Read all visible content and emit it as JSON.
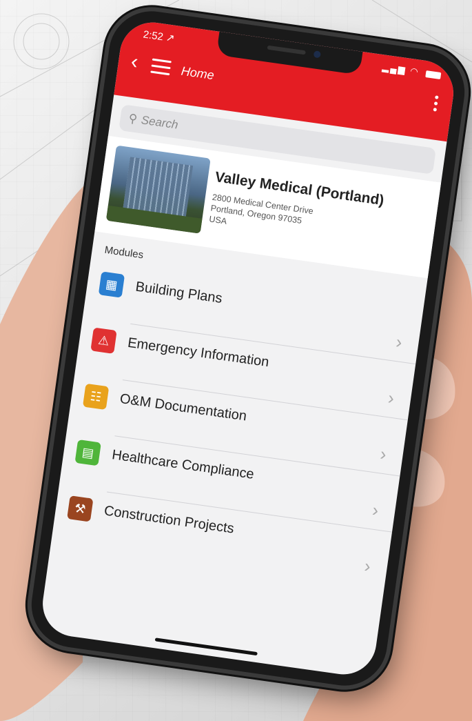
{
  "status": {
    "time": "2:52 ↗"
  },
  "header": {
    "back_icon": "chevron-left",
    "menu_icon": "hamburger",
    "title": "Home",
    "more_icon": "kebab-vertical"
  },
  "search": {
    "placeholder": "Search"
  },
  "facility": {
    "name": "Valley Medical (Portland)",
    "address_line1": "2800 Medical Center Drive",
    "address_line2": "Portland, Oregon 97035",
    "address_line3": "USA"
  },
  "modules": {
    "label": "Modules",
    "items": [
      {
        "label": "Building Plans",
        "icon": "building-icon",
        "color": "#2a7fd1"
      },
      {
        "label": "Emergency Information",
        "icon": "alarm-icon",
        "color": "#e03232"
      },
      {
        "label": "O&M Documentation",
        "icon": "hvac-icon",
        "color": "#e9a21c"
      },
      {
        "label": "Healthcare Compliance",
        "icon": "document-icon",
        "color": "#4fb53a"
      },
      {
        "label": "Construction Projects",
        "icon": "crane-icon",
        "color": "#9a4520"
      }
    ]
  },
  "colors": {
    "appbar": "#e41d23"
  }
}
